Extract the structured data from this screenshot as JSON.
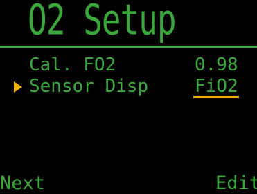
{
  "screen": {
    "title": "O2 Setup"
  },
  "menu": {
    "items": [
      {
        "label": "Cal. FO2",
        "value": "0.98"
      },
      {
        "label": "Sensor Disp",
        "value": "FiO2"
      }
    ]
  },
  "softkeys": {
    "left": "Next",
    "right": "Edit"
  },
  "colors": {
    "background": "#000000",
    "text": "#3aa83a",
    "accent": "#f0b400"
  }
}
